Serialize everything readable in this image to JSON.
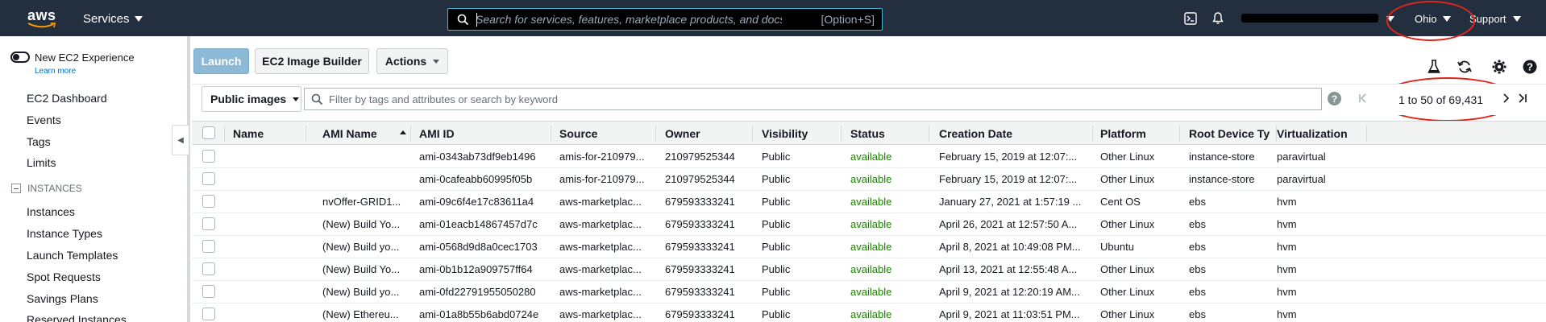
{
  "topnav": {
    "logo": "aws",
    "services_label": "Services",
    "search_placeholder": "Search for services, features, marketplace products, and docs",
    "search_shortcut": "[Option+S]",
    "region": "Ohio",
    "support": "Support"
  },
  "sidebar": {
    "new_experience": "New EC2 Experience",
    "learn_more": "Learn more",
    "links": [
      "EC2 Dashboard",
      "Events",
      "Tags",
      "Limits"
    ],
    "section_instances": "INSTANCES",
    "instance_links": [
      "Instances",
      "Instance Types",
      "Launch Templates",
      "Spot Requests",
      "Savings Plans",
      "Reserved Instances"
    ]
  },
  "toolbar": {
    "launch": "Launch",
    "image_builder": "EC2 Image Builder",
    "actions": "Actions"
  },
  "filter": {
    "select_value": "Public images",
    "placeholder": "Filter by tags and attributes or search by keyword",
    "help": "?",
    "page_info": "1 to 50 of 69,431"
  },
  "table": {
    "columns": [
      "Name",
      "AMI Name",
      "AMI ID",
      "Source",
      "Owner",
      "Visibility",
      "Status",
      "Creation Date",
      "Platform",
      "Root Device Ty",
      "Virtualization"
    ],
    "rows": [
      [
        "",
        "",
        "ami-0343ab73df9eb1496",
        "amis-for-210979...",
        "210979525344",
        "Public",
        "available",
        "February 15, 2019 at 12:07:...",
        "Other Linux",
        "instance-store",
        "paravirtual"
      ],
      [
        "",
        "",
        "ami-0cafeabb60995f05b",
        "amis-for-210979...",
        "210979525344",
        "Public",
        "available",
        "February 15, 2019 at 12:07:...",
        "Other Linux",
        "instance-store",
        "paravirtual"
      ],
      [
        "",
        "nvOffer-GRID1...",
        "ami-09c6f4e17c83611a4",
        "aws-marketplac...",
        "679593333241",
        "Public",
        "available",
        "January 27, 2021 at 1:57:19 ...",
        "Cent OS",
        "ebs",
        "hvm"
      ],
      [
        "",
        "(New) Build Yo...",
        "ami-01eacb14867457d7c",
        "aws-marketplac...",
        "679593333241",
        "Public",
        "available",
        "April 26, 2021 at 12:57:50 A...",
        "Other Linux",
        "ebs",
        "hvm"
      ],
      [
        "",
        "(New) Build yo...",
        "ami-0568d9d8a0cec1703",
        "aws-marketplac...",
        "679593333241",
        "Public",
        "available",
        "April 8, 2021 at 10:49:08 PM...",
        "Ubuntu",
        "ebs",
        "hvm"
      ],
      [
        "",
        "(New) Build Yo...",
        "ami-0b1b12a909757ff64",
        "aws-marketplac...",
        "679593333241",
        "Public",
        "available",
        "April 13, 2021 at 12:55:48 A...",
        "Other Linux",
        "ebs",
        "hvm"
      ],
      [
        "",
        "(New) Build yo...",
        "ami-0fd22791955050280",
        "aws-marketplac...",
        "679593333241",
        "Public",
        "available",
        "April 9, 2021 at 12:20:19 AM...",
        "Other Linux",
        "ebs",
        "hvm"
      ],
      [
        "",
        "(New) Ethereu...",
        "ami-01a8b55b6abd0724e",
        "aws-marketplac...",
        "679593333241",
        "Public",
        "available",
        "April 9, 2021 at 11:03:51 PM...",
        "Other Linux",
        "ebs",
        "hvm"
      ]
    ]
  },
  "colors": {
    "nav_bg": "#232f3e",
    "accent_link": "#0073bb",
    "status_available": "#1d8102",
    "annotation": "#e0261b"
  }
}
